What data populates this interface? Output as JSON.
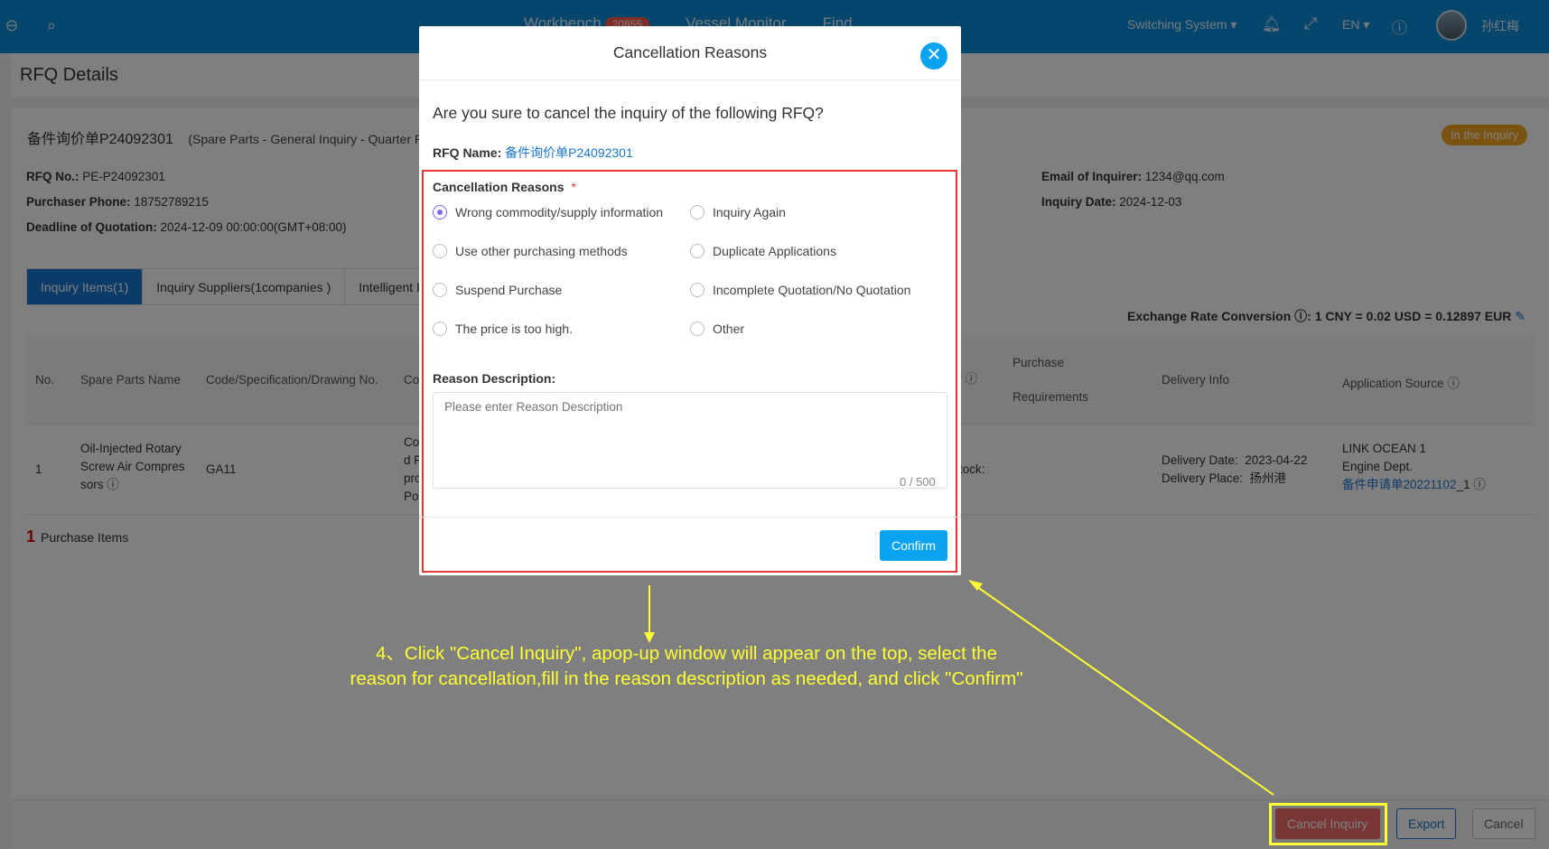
{
  "topbar": {
    "nav": [
      {
        "label": "Workbench",
        "badge": "20855"
      },
      {
        "label": "Vessel Monitor"
      },
      {
        "label": "Find"
      }
    ],
    "switching_system": "Switching System ▾",
    "language": "EN ▾",
    "user_name": "孙红梅"
  },
  "page": {
    "title": "RFQ Details",
    "rfq_title": "备件询价单P24092301",
    "rfq_subtitle": "(Spare Parts - General Inquiry - Quarter P",
    "status": "In the Inquiry",
    "info": {
      "rfq_no_label": "RFQ No.:",
      "rfq_no": "PE-P24092301",
      "phone_label": "Purchaser Phone:",
      "phone": "18752789215",
      "deadline_label": "Deadline of Quotation:",
      "deadline": "2024-12-09 00:00:00(GMT+08:00)",
      "email_label": "Email of Inquirer:",
      "email": "1234@qq.com",
      "date_label": "Inquiry Date:",
      "date": "2024-12-03"
    },
    "tabs": [
      "Inquiry Items(1)",
      "Inquiry Suppliers(1companies )",
      "Intelligent I"
    ],
    "exchange_rate": "Exchange Rate Conversion ⓘ:  1 CNY = 0.02 USD = 0.12897 EUR",
    "table": {
      "headers": {
        "no": "No.",
        "name": "Spare Parts Name",
        "code": "Code/Specification/Drawing No.",
        "col_c": "Co",
        "col_y": "y ⓘ",
        "purchase": "Purchase",
        "requirements": "Requirements",
        "delivery": "Delivery Info",
        "source": "Application Source ⓘ"
      },
      "row": {
        "no": "1",
        "name_1": "Oil-Injected Rotary",
        "name_2": "Screw Air Compres",
        "name_3": "sors ⓘ",
        "code": "GA11",
        "cut_1": "Co",
        "cut_2": "d F",
        "cut_3": "pro",
        "cut_4": "Po",
        "stock": "tock:",
        "delivery_date_label": "Delivery Date:",
        "delivery_date": "2023-04-22",
        "delivery_place_label": "Delivery Place:",
        "delivery_place": "扬州港",
        "source_1": "LINK OCEAN 1",
        "source_2": "Engine Dept.",
        "source_link": "备件申请单20221102",
        "source_suffix": "_1 ⓘ"
      }
    },
    "count_num": "1",
    "count_label": "Purchase Items",
    "footer": {
      "cancel_inquiry": "Cancel Inquiry",
      "export": "Export",
      "cancel": "Cancel"
    }
  },
  "modal": {
    "title": "Cancellation Reasons",
    "question": "Are you sure to cancel the inquiry of the following RFQ?",
    "rfq_name_label": "RFQ Name:",
    "rfq_name": "备件询价单P24092301",
    "reasons_label": "Cancellation Reasons",
    "required_mark": "*",
    "options": [
      "Wrong commodity/supply information",
      "Inquiry Again",
      "Use other purchasing methods",
      "Duplicate Applications",
      "Suspend Purchase",
      "Incomplete Quotation/No Quotation",
      "The price is too high.",
      "Other"
    ],
    "selected_option": "Wrong commodity/supply information",
    "desc_label": "Reason Description:",
    "desc_placeholder": "Please enter Reason Description",
    "counter": "0 / 500",
    "confirm": "Confirm"
  },
  "annotation": {
    "line1": "4、Click \"Cancel Inquiry\", apop-up window will appear on the top, select the",
    "line2": "reason for cancellation,fill in the reason description as needed, and click \"Confirm\""
  },
  "colors": {
    "topbar": "#0d8bd8",
    "accent": "#0aa3f2",
    "highlight_red": "#e53935",
    "annotation_yellow": "#ffff33",
    "status_orange": "#f5a623"
  }
}
